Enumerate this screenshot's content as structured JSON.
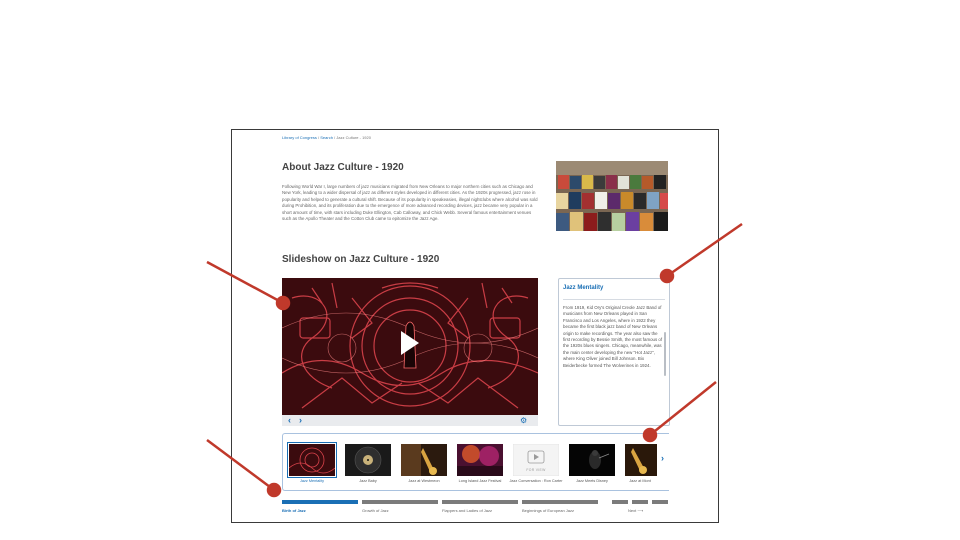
{
  "breadcrumb": {
    "items": [
      "Library of Congress",
      "Search",
      "Jazz Culture - 1920"
    ],
    "separator": " / "
  },
  "about": {
    "title": "About Jazz Culture - 1920",
    "text": "Following World War I, large numbers of jazz musicians migrated from New Orleans to major northern cities such as Chicago and New York, leading to a wider dispersal of jazz as different styles developed in different cities. As the 1920s progressed, jazz rose in popularity and helped to generate a cultural shift. Because of its popularity in speakeasies, illegal nightclubs where alcohol was sold during Prohibition, and its proliferation due to the emergence of more advanced recording devices, jazz became very popular in a short amount of time, with stars including Duke Ellington, Cab Calloway, and Chick Webb. Several famous entertainment venues such as the Apollo Theater and the Cotton Club came to epitomize the Jazz Age."
  },
  "slideshow": {
    "title": "Slideshow on Jazz Culture - 1920",
    "controls": {
      "prev": "‹",
      "next": "›",
      "settings": "⚙"
    }
  },
  "info_panel": {
    "title": "Jazz Mentality",
    "text": "From 1919, Kid Ory's Original Creole Jazz Band of musicians from New Orleans played in San Francisco and Los Angeles, where in 1922 they became the first black jazz band of New Orleans origin to make recordings. The year also saw the first recording by Bessie Smith, the most famous of the 1920s blues singers. Chicago, meanwhile, was the main center developing the new \"Hot Jazz\", where King Oliver joined Bill Johnson. Bix Beiderbecke formed The Wolverines in 1924."
  },
  "thumbnails": [
    {
      "label": "Jazz Mentality",
      "active": true
    },
    {
      "label": "Jazz Baby",
      "active": false
    },
    {
      "label": "Jazz at Westmeon",
      "active": false
    },
    {
      "label": "Long Island Jazz Festival",
      "active": false
    },
    {
      "label": "Jazz Conversation : Ron Carter",
      "active": false,
      "placeholder": "FOR VIEW"
    },
    {
      "label": "Jazz Meets Disney",
      "active": false
    },
    {
      "label": "Jazz at Mont",
      "active": false
    }
  ],
  "thumb_strip_next": "›",
  "timeline": [
    {
      "label": "Birth of Jazz",
      "active": true
    },
    {
      "label": "Growth of Jazz",
      "active": false
    },
    {
      "label": "Flappers and Ladies of Jazz",
      "active": false
    },
    {
      "label": "Beginnings of European Jazz",
      "active": false
    },
    {
      "label": "Next ⟶",
      "active": false
    }
  ],
  "icons": {
    "play": "play-icon",
    "settings": "gear-icon",
    "prev": "chevron-left-icon",
    "next": "chevron-right-icon"
  },
  "colors": {
    "accent": "#1a6fb5",
    "annotation": "#c0392b",
    "timeline_inactive": "#7b7b7b",
    "frame_border": "#3a3a3a"
  }
}
